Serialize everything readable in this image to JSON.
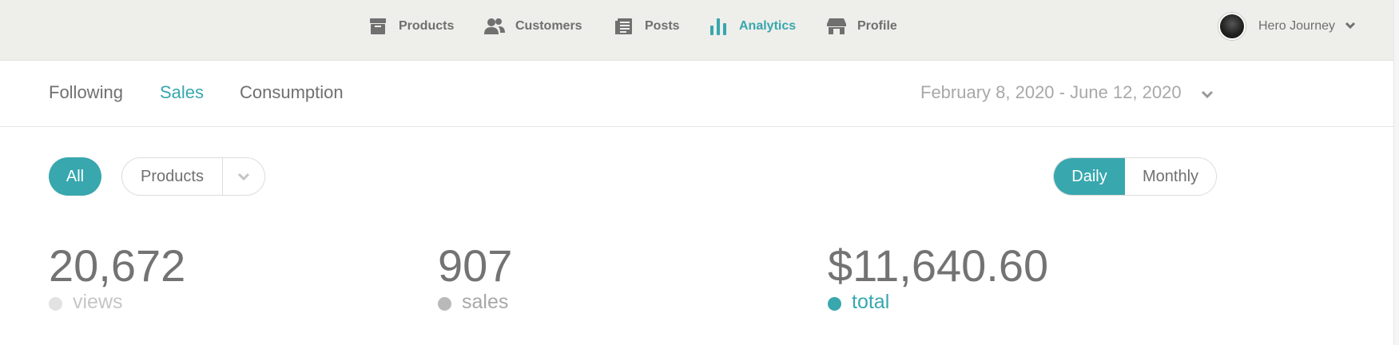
{
  "nav": {
    "items": [
      {
        "label": "Products",
        "icon": "archive-box-icon",
        "active": false
      },
      {
        "label": "Customers",
        "icon": "users-icon",
        "active": false
      },
      {
        "label": "Posts",
        "icon": "document-list-icon",
        "active": false
      },
      {
        "label": "Analytics",
        "icon": "bar-chart-icon",
        "active": true
      },
      {
        "label": "Profile",
        "icon": "storefront-icon",
        "active": false
      }
    ],
    "user": {
      "name": "Hero Journey"
    }
  },
  "subtabs": {
    "items": [
      {
        "label": "Following",
        "active": false
      },
      {
        "label": "Sales",
        "active": true
      },
      {
        "label": "Consumption",
        "active": false
      }
    ],
    "date_range": "February 8, 2020 - June 12, 2020"
  },
  "filters": {
    "all_label": "All",
    "products_label": "Products",
    "granularity": {
      "daily": "Daily",
      "monthly": "Monthly",
      "selected": "Daily"
    }
  },
  "stats": {
    "views": {
      "value": "20,672",
      "label": "views"
    },
    "sales": {
      "value": "907",
      "label": "sales"
    },
    "total": {
      "value": "$11,640.60",
      "label": "total"
    }
  },
  "colors": {
    "accent": "#38a7ae",
    "topbar": "#eeeeea",
    "text": "#737373"
  }
}
